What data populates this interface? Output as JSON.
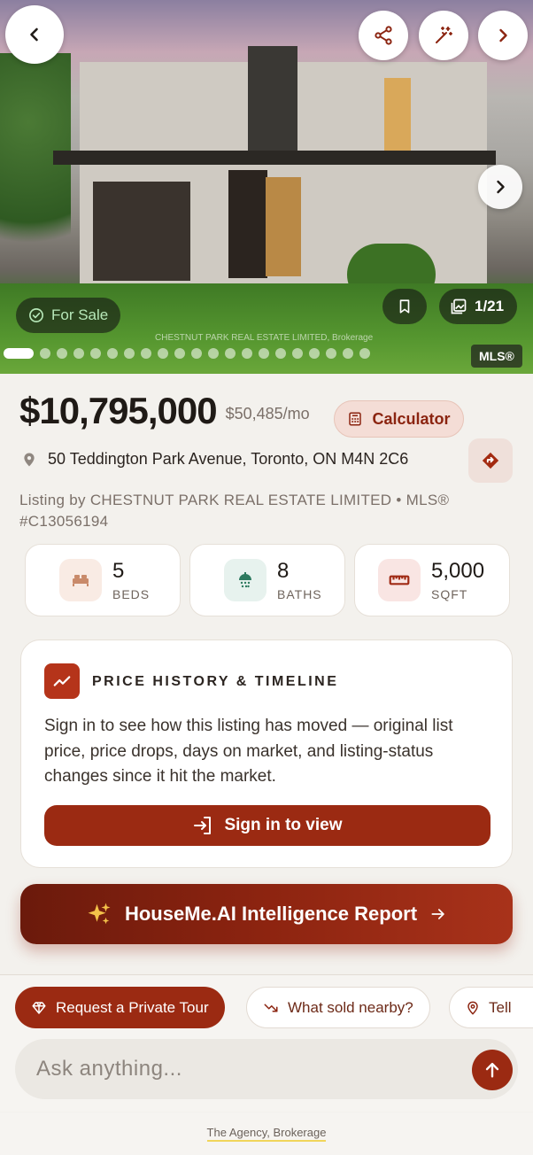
{
  "hero": {
    "watermark": "CHESTNUT PARK REAL ESTATE LIMITED, Brokerage",
    "status_label": "For Sale",
    "photo_counter": "1/21",
    "mls_badge": "MLS®",
    "photo_index": 1,
    "photo_total": 21
  },
  "listing": {
    "price": "$10,795,000",
    "monthly": "$50,485/mo",
    "calculator_label": "Calculator",
    "address": "50 Teddington Park Avenue, Toronto, ON M4N 2C6",
    "listing_by": "Listing by CHESTNUT PARK REAL ESTATE LIMITED • MLS® #C13056194"
  },
  "stats": [
    {
      "value": "5",
      "label": "BEDS",
      "icon": "bed-icon",
      "color": "#f9ebe4"
    },
    {
      "value": "8",
      "label": "BATHS",
      "icon": "shower-icon",
      "color": "#e7f2ee"
    },
    {
      "value": "5,000",
      "label": "SQFT",
      "icon": "ruler-icon",
      "color": "#f9e5e3"
    }
  ],
  "history": {
    "title": "PRICE HISTORY & TIMELINE",
    "text": "Sign in to see how this listing has moved — original list price, price drops, days on market, and listing-status changes since it hit the market.",
    "button": "Sign in to view"
  },
  "ai_report": {
    "label": "HouseMe.AI Intelligence Report"
  },
  "chips": [
    {
      "label": "Request a Private Tour"
    },
    {
      "label": "What sold nearby?"
    },
    {
      "label": "Tell"
    }
  ],
  "ask": {
    "placeholder": "Ask anything..."
  },
  "footer": {
    "brokerage": "The Agency, Brokerage"
  },
  "colors": {
    "accent": "#9b2a12",
    "background": "#f3f1ed"
  }
}
